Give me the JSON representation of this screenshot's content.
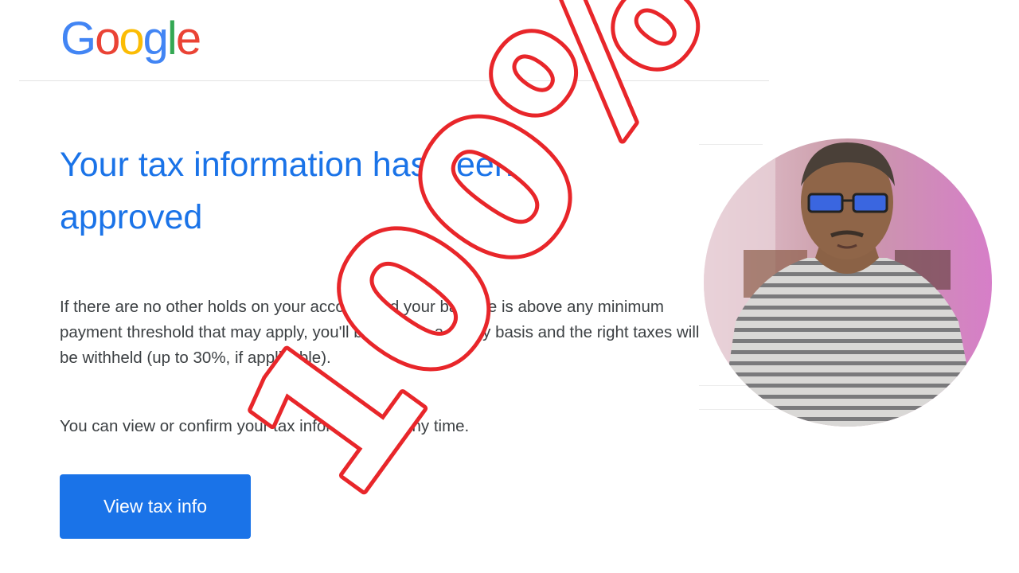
{
  "logo": {
    "letters": [
      "G",
      "o",
      "o",
      "g",
      "l",
      "e"
    ],
    "colors": [
      "#4285F4",
      "#EA4335",
      "#FBBC05",
      "#4285F4",
      "#34A853",
      "#EA4335"
    ]
  },
  "email": {
    "title": "Your tax information has been approved",
    "paragraph1": "If there are no other holds on your account and your balance is above any minimum payment threshold that may apply, you'll be paid on a timely basis and the right taxes will be withheld (up to 30%, if applicable).",
    "paragraph2": "You can view or confirm your tax information at any time.",
    "button_label": "View tax info"
  },
  "overlay": {
    "stamp_text": "100%",
    "stamp_color": "#e8262a"
  },
  "colors": {
    "accent": "#1a73e8",
    "body_text": "#3c4043"
  }
}
